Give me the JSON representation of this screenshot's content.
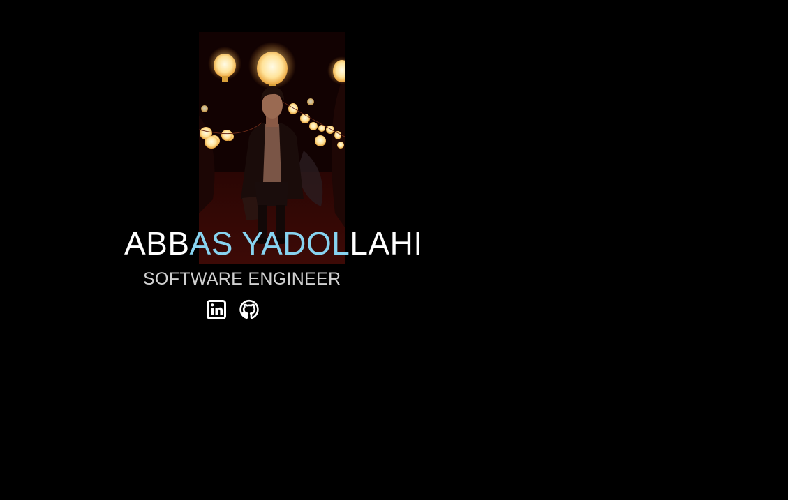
{
  "profile": {
    "name_parts": [
      "ABB",
      "AS YADOL",
      "LAHI"
    ],
    "title": "SOFTWARE ENGINEER"
  },
  "socials": [
    {
      "icon": "linkedin-icon",
      "label": "LinkedIn"
    },
    {
      "icon": "github-icon",
      "label": "GitHub"
    }
  ],
  "colors": {
    "background": "#000000",
    "name_primary": "#ffffff",
    "name_accent": "#87d3f0",
    "title": "#d0d0d0",
    "icons": "#ffffff"
  }
}
